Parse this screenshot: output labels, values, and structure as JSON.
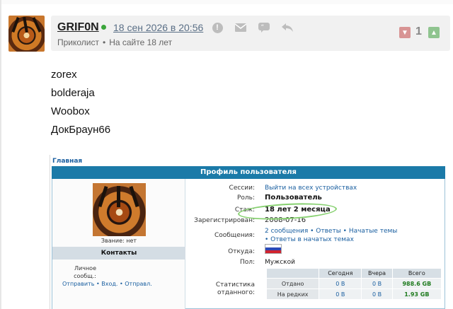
{
  "post": {
    "username": "GRIF0N",
    "date": "18 сен 2026 в 20:56",
    "role": "Приколист",
    "separator": "•",
    "tenure": "На сайте 18 лет",
    "vote_down_icon": "thumb-down-icon",
    "vote_count": "1",
    "vote_up_icon": "thumb-up-icon",
    "actions": [
      "report-icon",
      "message-icon",
      "quote-icon",
      "reply-icon"
    ],
    "lines": [
      "zorex",
      "bolderaja",
      "Woobox",
      "ДокБраун66"
    ]
  },
  "embedded_profile": {
    "breadcrumb": "Главная",
    "title": "Профиль пользователя",
    "rank_label": "Звание: нет",
    "contacts_title": "Контакты",
    "contact_personal_label": "Личное сообщ.:",
    "contact_links": "Отправить • Вход. • Отправл.",
    "fields": {
      "sessions_label": "Сессии:",
      "sessions_value": "Выйти на всех устройствах",
      "role_label": "Роль:",
      "role_value": "Пользователь",
      "tenure_label": "Стаж:",
      "tenure_value": "18 лет 2 месяца",
      "registered_label": "Зарегистрирован:",
      "registered_value": "2008-07-16",
      "messages_label": "Сообщения:",
      "messages_value_1": "2 сообщения • Ответы • Начатые темы",
      "messages_value_2": "• Ответы в начатых темах",
      "from_label": "Откуда:",
      "gender_label": "Пол:",
      "gender_value": "Мужской",
      "stats_label": "Статистика отданного:"
    },
    "stats": {
      "headers": [
        "",
        "Сегодня",
        "Вчера",
        "Всего"
      ],
      "rows": [
        [
          "Отдано",
          "0 B",
          "0 B",
          "988.6 GB"
        ],
        [
          "На редких",
          "0 B",
          "0 B",
          "1.93 GB"
        ]
      ]
    },
    "colors": {
      "titlebar": "#1b7aa8",
      "link": "#1a5fa0",
      "highlight": "#86d06f"
    }
  }
}
